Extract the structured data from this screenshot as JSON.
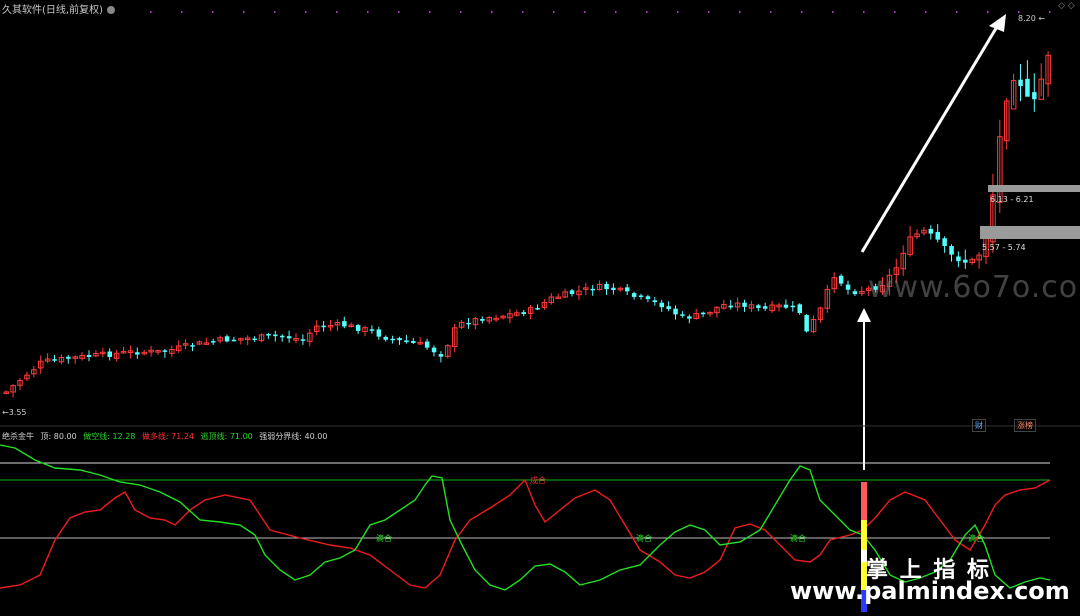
{
  "header": {
    "title": "久其软件(日线,前复权)",
    "corner": "◇ ◇"
  },
  "price_labels": {
    "high": "8.20",
    "low": "3.55"
  },
  "zones": [
    {
      "label": "6.13 - 6.21"
    },
    {
      "label": "5.57 - 5.74"
    }
  ],
  "indicator": {
    "name": "绝杀金牛",
    "top_text": "顶: 80.00",
    "line1": "做空线: 12.28",
    "line2": "做多线: 71.24",
    "line3": "逃顶线: 71.00",
    "line4": "强弱分界线: 40.00",
    "markers": [
      "成合",
      "滴合",
      "滴合",
      "滴合",
      "滴合"
    ]
  },
  "badges": {
    "finance": "财",
    "news": "涨榜"
  },
  "watermarks": {
    "mid": "www.6o7o.com",
    "cn": "掌 上 指 标",
    "url": "www.palmindex.com"
  },
  "colors": {
    "up": "#ff3b3b",
    "down": "#54ffff",
    "green_line": "#1fd01f",
    "red_line": "#ee1c1c",
    "level_line": "#cfcfcf"
  }
}
